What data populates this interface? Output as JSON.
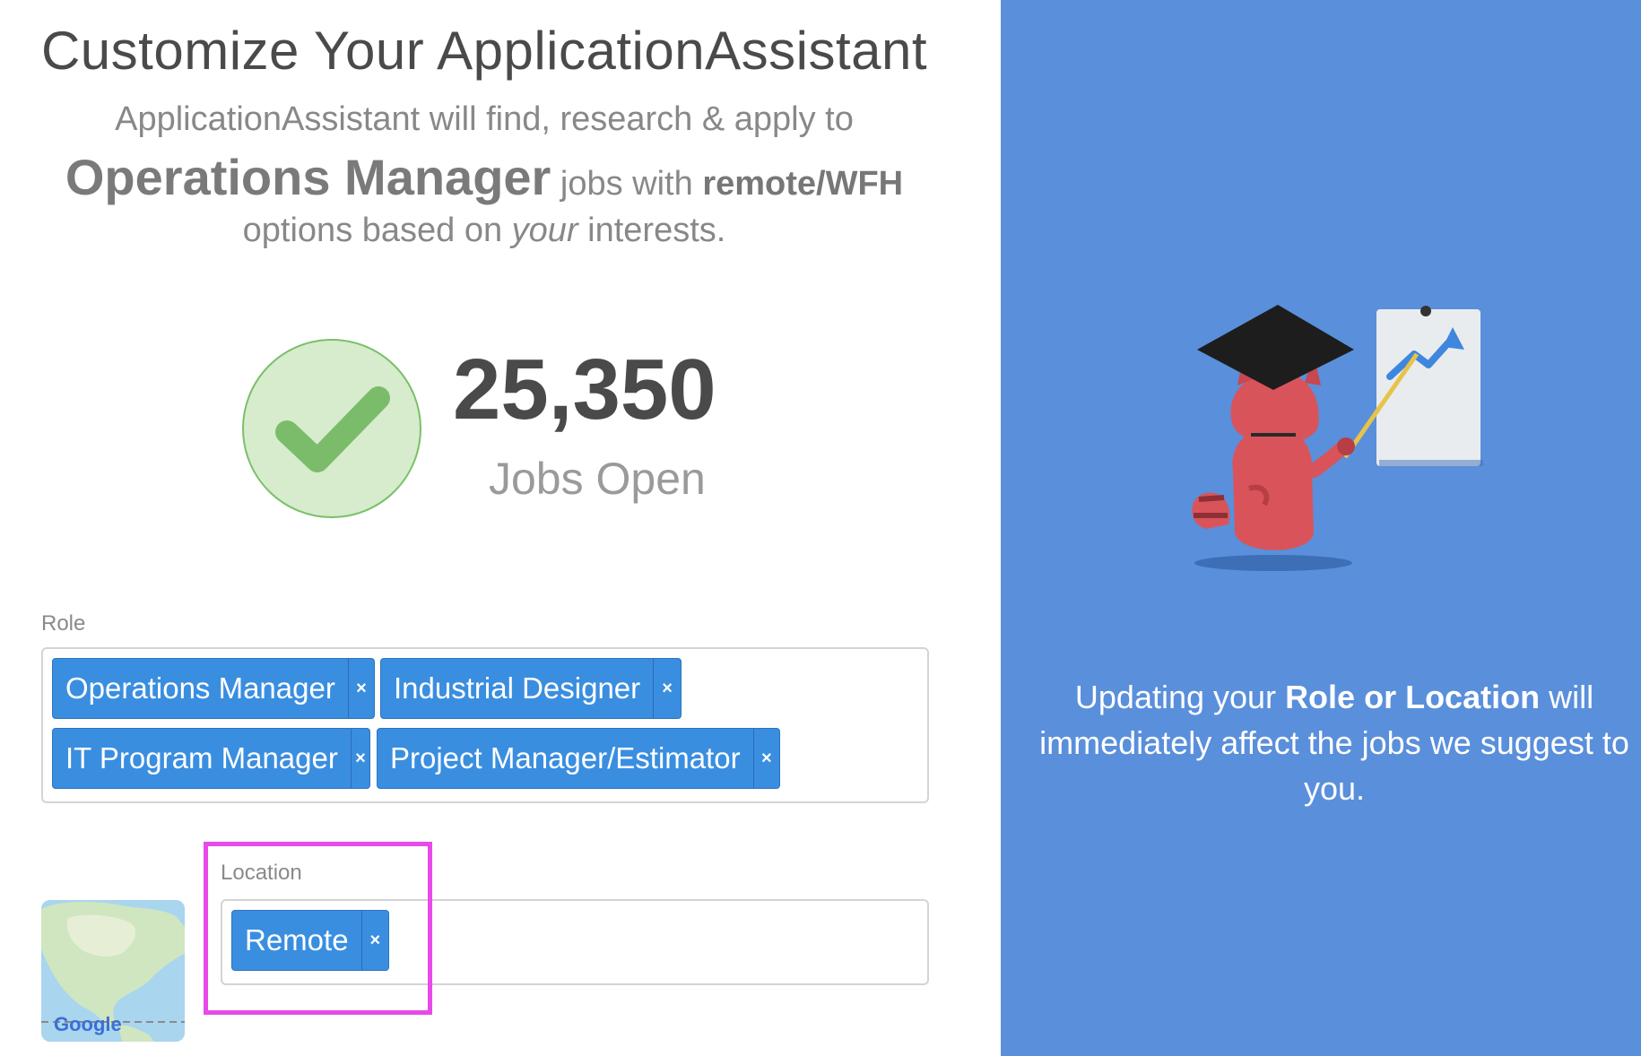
{
  "header": {
    "title": "Customize Your ApplicationAssistant",
    "line1": "ApplicationAssistant will find, research & apply to",
    "role": "Operations Manager",
    "jobs_with": "jobs with",
    "work_mode": "remote/WFH",
    "line3_pre": "options based on",
    "line3_em": "your",
    "line3_post": "interests."
  },
  "stats": {
    "count": "25,350",
    "label": "Jobs Open"
  },
  "role_field": {
    "label": "Role",
    "tags": [
      "Operations Manager",
      "Industrial Designer",
      "IT Program Manager",
      "Project Manager/Estimator"
    ],
    "remove_glyph": "×"
  },
  "location_field": {
    "label": "Location",
    "tags": [
      "Remote"
    ]
  },
  "map": {
    "brand": "Google"
  },
  "panel": {
    "text_pre": "Updating your",
    "text_bold": "Role or Location",
    "text_post": "will immediately affect the jobs we suggest to you."
  },
  "colors": {
    "accent_blue": "#3a8ee0",
    "panel_blue": "#5a8fdb",
    "success_green": "#7bbf6a",
    "highlight_magenta": "#e84ae8"
  }
}
